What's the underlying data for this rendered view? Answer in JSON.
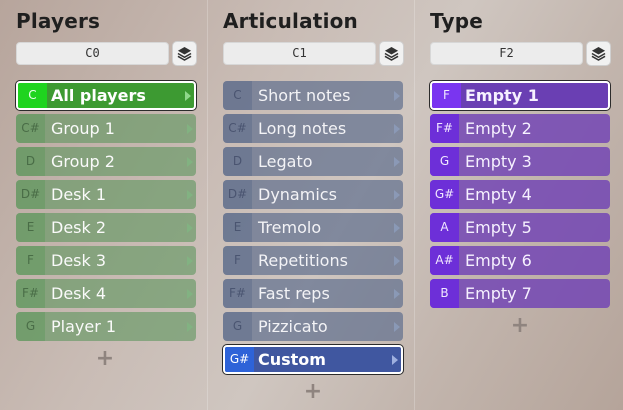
{
  "columns": [
    {
      "title": "Players",
      "key_value": "C0",
      "items": [
        {
          "key": "C",
          "label": "All players"
        },
        {
          "key": "C#",
          "label": "Group 1"
        },
        {
          "key": "D",
          "label": "Group 2"
        },
        {
          "key": "D#",
          "label": "Desk 1"
        },
        {
          "key": "E",
          "label": "Desk 2"
        },
        {
          "key": "F",
          "label": "Desk 3"
        },
        {
          "key": "F#",
          "label": "Desk 4"
        },
        {
          "key": "G",
          "label": "Player 1"
        }
      ],
      "selected_index": 0,
      "add_label": "+"
    },
    {
      "title": "Articulation",
      "key_value": "C1",
      "items": [
        {
          "key": "C",
          "label": "Short notes"
        },
        {
          "key": "C#",
          "label": "Long notes"
        },
        {
          "key": "D",
          "label": "Legato"
        },
        {
          "key": "D#",
          "label": "Dynamics"
        },
        {
          "key": "E",
          "label": "Tremolo"
        },
        {
          "key": "F",
          "label": "Repetitions"
        },
        {
          "key": "F#",
          "label": "Fast reps"
        },
        {
          "key": "G",
          "label": "Pizzicato"
        },
        {
          "key": "G#",
          "label": "Custom"
        }
      ],
      "selected_index": 8,
      "add_label": "+"
    },
    {
      "title": "Type",
      "key_value": "F2",
      "items": [
        {
          "key": "F",
          "label": "Empty 1"
        },
        {
          "key": "F#",
          "label": "Empty 2"
        },
        {
          "key": "G",
          "label": "Empty 3"
        },
        {
          "key": "G#",
          "label": "Empty 4"
        },
        {
          "key": "A",
          "label": "Empty 5"
        },
        {
          "key": "A#",
          "label": "Empty 6"
        },
        {
          "key": "B",
          "label": "Empty 7"
        }
      ],
      "selected_index": 0,
      "add_label": "+"
    }
  ],
  "icons": {
    "layers": "layers-icon",
    "arrow": "chevron-right-icon"
  },
  "colors": {
    "players_accent": "#1fd41f",
    "articulation_accent": "#2e63d8",
    "type_accent": "#7a35f0"
  }
}
